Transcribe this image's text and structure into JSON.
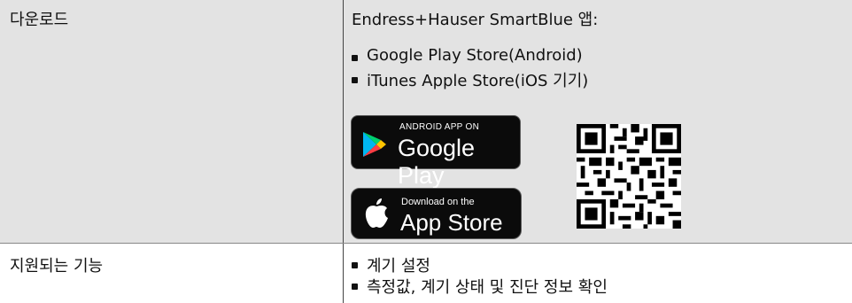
{
  "rows": [
    {
      "label": "다운로드",
      "intro": "Endress+Hauser SmartBlue 앱:",
      "bullets": [
        "Google Play Store(Android)",
        "iTunes Apple Store(iOS 기기)"
      ]
    },
    {
      "label": "지원되는 기능",
      "bullets": [
        "계기 설정",
        "측정값, 계기 상태 및 진단 정보 확인"
      ]
    }
  ],
  "google_badge": {
    "small_text": "ANDROID APP ON",
    "big_text": "Google Play"
  },
  "apple_badge": {
    "small_text": "Download on the",
    "big_text": "App Store"
  },
  "colors": {
    "row_background": "#e3e3e3",
    "divider": "#444444",
    "play_green": "#00d16f",
    "play_blue": "#00b6f0",
    "play_yellow": "#ffc400",
    "play_red": "#ff3d44"
  },
  "icons": [
    "google-play-triangle-icon",
    "apple-logo-icon",
    "qr-code"
  ]
}
